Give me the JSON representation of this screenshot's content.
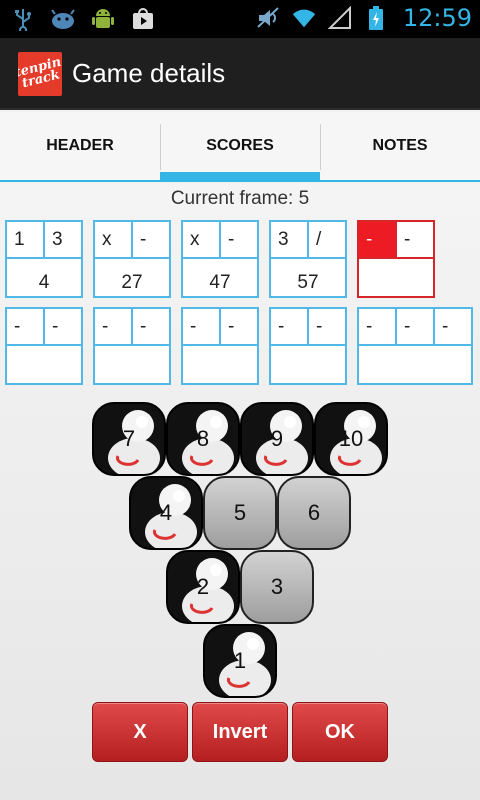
{
  "status_bar": {
    "time": "12:59",
    "icons": [
      "usb-icon",
      "android-bug-icon",
      "android-robot-icon",
      "play-store-icon",
      "mute-icon",
      "wifi-icon",
      "signal-icon",
      "battery-charging-icon"
    ]
  },
  "action_bar": {
    "logo_text": "tenpin track",
    "title": "Game details"
  },
  "tabs": [
    {
      "label": "HEADER",
      "active": false
    },
    {
      "label": "SCORES",
      "active": true
    },
    {
      "label": "NOTES",
      "active": false
    }
  ],
  "current_frame_text": "Current frame: 5",
  "frames": [
    {
      "balls": [
        "1",
        "3"
      ],
      "total": "4"
    },
    {
      "balls": [
        "x",
        "-"
      ],
      "total": "27"
    },
    {
      "balls": [
        "x",
        "-"
      ],
      "total": "47"
    },
    {
      "balls": [
        "3",
        "/"
      ],
      "total": "57"
    },
    {
      "balls": [
        "-",
        "-"
      ],
      "total": ""
    },
    {
      "balls": [
        "-",
        "-"
      ],
      "total": ""
    },
    {
      "balls": [
        "-",
        "-"
      ],
      "total": ""
    },
    {
      "balls": [
        "-",
        "-"
      ],
      "total": ""
    },
    {
      "balls": [
        "-",
        "-"
      ],
      "total": ""
    },
    {
      "balls": [
        "-",
        "-",
        "-"
      ],
      "total": ""
    }
  ],
  "pins": [
    {
      "label": "7",
      "standing": true
    },
    {
      "label": "8",
      "standing": true
    },
    {
      "label": "9",
      "standing": true
    },
    {
      "label": "10",
      "standing": true
    },
    {
      "label": "4",
      "standing": true
    },
    {
      "label": "5",
      "standing": false
    },
    {
      "label": "6",
      "standing": false
    },
    {
      "label": "2",
      "standing": true
    },
    {
      "label": "3",
      "standing": false
    },
    {
      "label": "1",
      "standing": true
    }
  ],
  "buttons": {
    "x_label": "X",
    "invert_label": "Invert",
    "ok_label": "OK"
  },
  "colors": {
    "accent": "#33b5e5",
    "current_frame_border": "#d7262a",
    "button_red": "#c62828"
  }
}
